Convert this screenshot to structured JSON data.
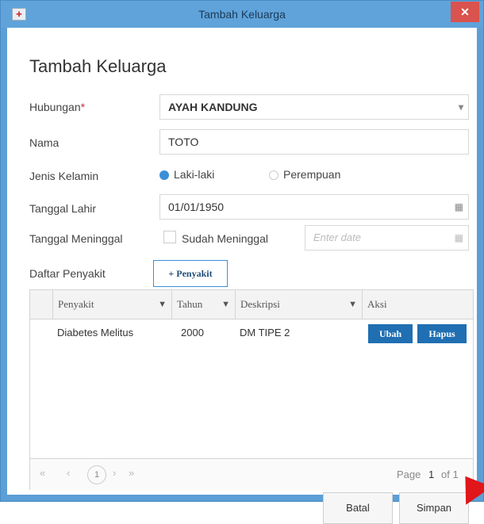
{
  "window": {
    "title": "Tambah Keluarga"
  },
  "form": {
    "heading": "Tambah Keluarga",
    "hubungan": {
      "label": "Hubungan",
      "required_mark": "*",
      "value": "AYAH KANDUNG"
    },
    "nama": {
      "label": "Nama",
      "value": "TOTO"
    },
    "jenis_kelamin": {
      "label": "Jenis Kelamin",
      "options": [
        "Laki-laki",
        "Perempuan"
      ],
      "selected": "Laki-laki"
    },
    "tanggal_lahir": {
      "label": "Tanggal Lahir",
      "value": "01/01/1950"
    },
    "tanggal_meninggal": {
      "label": "Tanggal Meninggal",
      "checkbox_label": "Sudah Meninggal",
      "checked": false,
      "placeholder": "Enter date"
    },
    "daftar_penyakit": {
      "label": "Daftar Penyakit",
      "add_button": "+ Penyakit"
    }
  },
  "grid": {
    "columns": [
      "Penyakit",
      "Tahun",
      "Deskripsi",
      "Aksi"
    ],
    "filter_icon": "filter-icon",
    "rows": [
      {
        "penyakit": "Diabetes Melitus",
        "tahun": "2000",
        "deskripsi": "DM TIPE 2",
        "actions": [
          "Ubah",
          "Hapus"
        ]
      }
    ],
    "pager": {
      "first": "«",
      "prev": "‹",
      "current": "1",
      "next": "›",
      "last": "»",
      "page_label": "Page",
      "page_num": "1",
      "of_label": "of 1"
    }
  },
  "footer": {
    "cancel": "Batal",
    "save": "Simpan"
  },
  "colors": {
    "titlebar": "#5fa3da",
    "close": "#d9534f",
    "action_button": "#1f6fb2",
    "cursor": "#e0161b"
  }
}
